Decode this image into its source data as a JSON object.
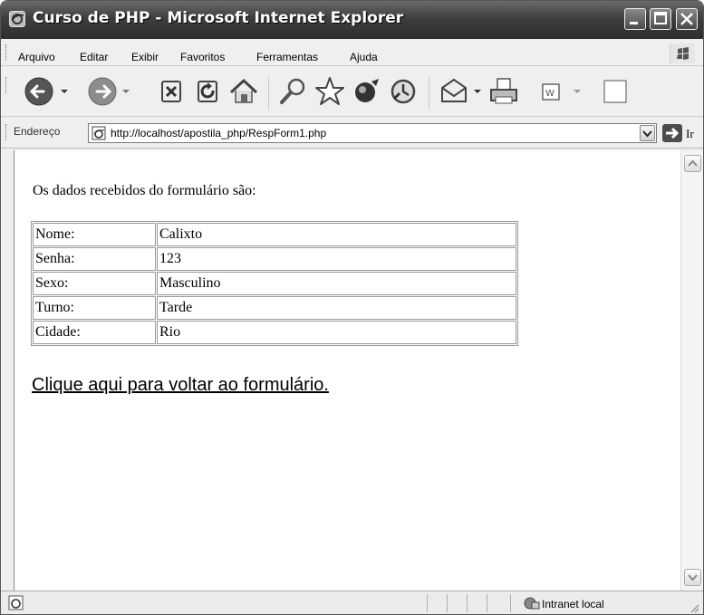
{
  "window": {
    "title": "Curso de PHP - Microsoft Internet Explorer"
  },
  "menu": [
    "Arquivo",
    "Editar",
    "Exibir",
    "Favoritos",
    "Ferramentas",
    "Ajuda"
  ],
  "address": {
    "label": "Endereço",
    "url": "http://localhost/apostila_php/RespForm1.php",
    "go": "Ir"
  },
  "page": {
    "intro": "Os dados recebidos do formulário são:",
    "rows": [
      {
        "label": "Nome:",
        "value": "Calixto"
      },
      {
        "label": "Senha:",
        "value": "123"
      },
      {
        "label": "Sexo:",
        "value": "Masculino"
      },
      {
        "label": "Turno:",
        "value": "Tarde"
      },
      {
        "label": "Cidade:",
        "value": "Rio"
      }
    ],
    "back_link": "Clique aqui para voltar ao formulário."
  },
  "status": {
    "zone": "Intranet local"
  }
}
